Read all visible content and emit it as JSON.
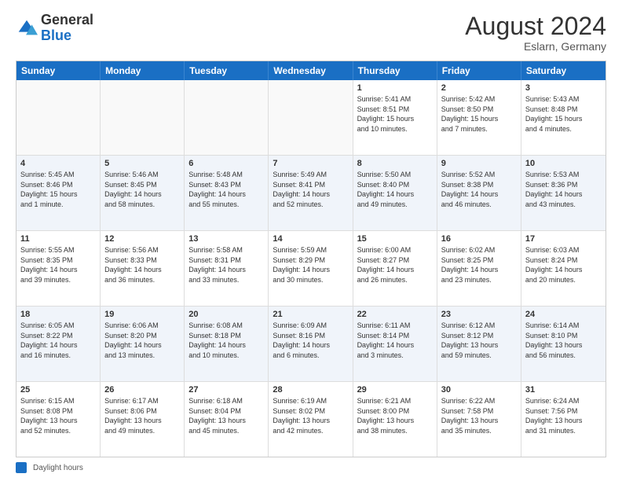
{
  "header": {
    "logo_general": "General",
    "logo_blue": "Blue",
    "month_year": "August 2024",
    "location": "Eslarn, Germany"
  },
  "day_headers": [
    "Sunday",
    "Monday",
    "Tuesday",
    "Wednesday",
    "Thursday",
    "Friday",
    "Saturday"
  ],
  "footer": {
    "legend_label": "Daylight hours"
  },
  "weeks": [
    [
      {
        "num": "",
        "info": "",
        "empty": true
      },
      {
        "num": "",
        "info": "",
        "empty": true
      },
      {
        "num": "",
        "info": "",
        "empty": true
      },
      {
        "num": "",
        "info": "",
        "empty": true
      },
      {
        "num": "1",
        "info": "Sunrise: 5:41 AM\nSunset: 8:51 PM\nDaylight: 15 hours\nand 10 minutes.",
        "empty": false
      },
      {
        "num": "2",
        "info": "Sunrise: 5:42 AM\nSunset: 8:50 PM\nDaylight: 15 hours\nand 7 minutes.",
        "empty": false
      },
      {
        "num": "3",
        "info": "Sunrise: 5:43 AM\nSunset: 8:48 PM\nDaylight: 15 hours\nand 4 minutes.",
        "empty": false
      }
    ],
    [
      {
        "num": "4",
        "info": "Sunrise: 5:45 AM\nSunset: 8:46 PM\nDaylight: 15 hours\nand 1 minute.",
        "empty": false
      },
      {
        "num": "5",
        "info": "Sunrise: 5:46 AM\nSunset: 8:45 PM\nDaylight: 14 hours\nand 58 minutes.",
        "empty": false
      },
      {
        "num": "6",
        "info": "Sunrise: 5:48 AM\nSunset: 8:43 PM\nDaylight: 14 hours\nand 55 minutes.",
        "empty": false
      },
      {
        "num": "7",
        "info": "Sunrise: 5:49 AM\nSunset: 8:41 PM\nDaylight: 14 hours\nand 52 minutes.",
        "empty": false
      },
      {
        "num": "8",
        "info": "Sunrise: 5:50 AM\nSunset: 8:40 PM\nDaylight: 14 hours\nand 49 minutes.",
        "empty": false
      },
      {
        "num": "9",
        "info": "Sunrise: 5:52 AM\nSunset: 8:38 PM\nDaylight: 14 hours\nand 46 minutes.",
        "empty": false
      },
      {
        "num": "10",
        "info": "Sunrise: 5:53 AM\nSunset: 8:36 PM\nDaylight: 14 hours\nand 43 minutes.",
        "empty": false
      }
    ],
    [
      {
        "num": "11",
        "info": "Sunrise: 5:55 AM\nSunset: 8:35 PM\nDaylight: 14 hours\nand 39 minutes.",
        "empty": false
      },
      {
        "num": "12",
        "info": "Sunrise: 5:56 AM\nSunset: 8:33 PM\nDaylight: 14 hours\nand 36 minutes.",
        "empty": false
      },
      {
        "num": "13",
        "info": "Sunrise: 5:58 AM\nSunset: 8:31 PM\nDaylight: 14 hours\nand 33 minutes.",
        "empty": false
      },
      {
        "num": "14",
        "info": "Sunrise: 5:59 AM\nSunset: 8:29 PM\nDaylight: 14 hours\nand 30 minutes.",
        "empty": false
      },
      {
        "num": "15",
        "info": "Sunrise: 6:00 AM\nSunset: 8:27 PM\nDaylight: 14 hours\nand 26 minutes.",
        "empty": false
      },
      {
        "num": "16",
        "info": "Sunrise: 6:02 AM\nSunset: 8:25 PM\nDaylight: 14 hours\nand 23 minutes.",
        "empty": false
      },
      {
        "num": "17",
        "info": "Sunrise: 6:03 AM\nSunset: 8:24 PM\nDaylight: 14 hours\nand 20 minutes.",
        "empty": false
      }
    ],
    [
      {
        "num": "18",
        "info": "Sunrise: 6:05 AM\nSunset: 8:22 PM\nDaylight: 14 hours\nand 16 minutes.",
        "empty": false
      },
      {
        "num": "19",
        "info": "Sunrise: 6:06 AM\nSunset: 8:20 PM\nDaylight: 14 hours\nand 13 minutes.",
        "empty": false
      },
      {
        "num": "20",
        "info": "Sunrise: 6:08 AM\nSunset: 8:18 PM\nDaylight: 14 hours\nand 10 minutes.",
        "empty": false
      },
      {
        "num": "21",
        "info": "Sunrise: 6:09 AM\nSunset: 8:16 PM\nDaylight: 14 hours\nand 6 minutes.",
        "empty": false
      },
      {
        "num": "22",
        "info": "Sunrise: 6:11 AM\nSunset: 8:14 PM\nDaylight: 14 hours\nand 3 minutes.",
        "empty": false
      },
      {
        "num": "23",
        "info": "Sunrise: 6:12 AM\nSunset: 8:12 PM\nDaylight: 13 hours\nand 59 minutes.",
        "empty": false
      },
      {
        "num": "24",
        "info": "Sunrise: 6:14 AM\nSunset: 8:10 PM\nDaylight: 13 hours\nand 56 minutes.",
        "empty": false
      }
    ],
    [
      {
        "num": "25",
        "info": "Sunrise: 6:15 AM\nSunset: 8:08 PM\nDaylight: 13 hours\nand 52 minutes.",
        "empty": false
      },
      {
        "num": "26",
        "info": "Sunrise: 6:17 AM\nSunset: 8:06 PM\nDaylight: 13 hours\nand 49 minutes.",
        "empty": false
      },
      {
        "num": "27",
        "info": "Sunrise: 6:18 AM\nSunset: 8:04 PM\nDaylight: 13 hours\nand 45 minutes.",
        "empty": false
      },
      {
        "num": "28",
        "info": "Sunrise: 6:19 AM\nSunset: 8:02 PM\nDaylight: 13 hours\nand 42 minutes.",
        "empty": false
      },
      {
        "num": "29",
        "info": "Sunrise: 6:21 AM\nSunset: 8:00 PM\nDaylight: 13 hours\nand 38 minutes.",
        "empty": false
      },
      {
        "num": "30",
        "info": "Sunrise: 6:22 AM\nSunset: 7:58 PM\nDaylight: 13 hours\nand 35 minutes.",
        "empty": false
      },
      {
        "num": "31",
        "info": "Sunrise: 6:24 AM\nSunset: 7:56 PM\nDaylight: 13 hours\nand 31 minutes.",
        "empty": false
      }
    ]
  ]
}
